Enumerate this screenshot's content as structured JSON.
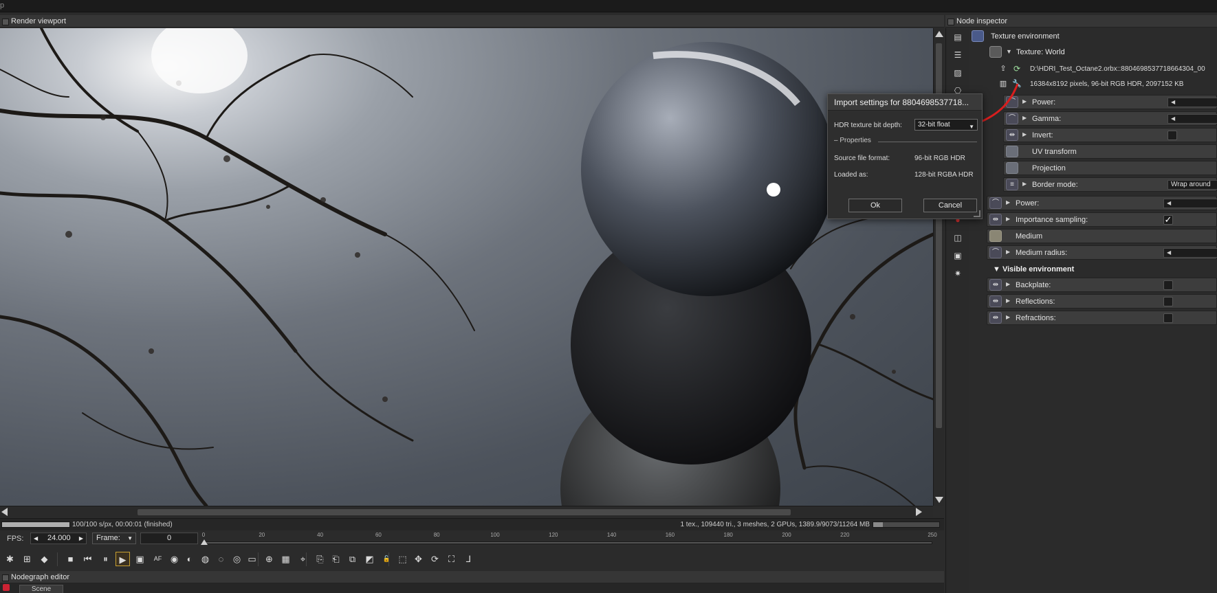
{
  "window": {
    "top_fragment": "p"
  },
  "viewport": {
    "title": "Render viewport",
    "status": "100/100 s/px, 00:00:01 (finished)",
    "stats": "1 tex., 109440 tri., 3 meshes, 2 GPUs, 1389.9/9073/11264 MB",
    "progress_fraction": 1.0,
    "memory_fraction": 0.15
  },
  "timeline": {
    "fps_label": "FPS:",
    "fps_value": "24.000",
    "frame_label": "Frame:",
    "frame_value": "0",
    "ticks": [
      "0",
      "20",
      "40",
      "60",
      "80",
      "100",
      "120",
      "140",
      "160",
      "180",
      "200",
      "220",
      "250"
    ],
    "tick_values": [
      0,
      20,
      40,
      60,
      80,
      100,
      120,
      140,
      160,
      180,
      200,
      220,
      250
    ],
    "range": [
      0,
      250
    ]
  },
  "toolbar": {
    "icons": [
      "reset-icon",
      "settings-icon",
      "cube-icon",
      "stop-icon",
      "restart-icon",
      "pause-icon",
      "play-icon",
      "display-icon",
      "af-icon",
      "color-icon",
      "cam-icon",
      "pick-icon",
      "pick2-icon",
      "pick3-icon",
      "region-icon",
      "zoom-icon",
      "crop-icon",
      "lock-icon",
      "export-icon",
      "import-icon",
      "layers-icon",
      "alpha-icon",
      "unlock-icon",
      "box-icon",
      "move-icon",
      "rotate-icon",
      "scale-icon",
      "axis-icon"
    ],
    "glyphs": [
      "✱",
      "⊞",
      "◆",
      "■",
      "⏮",
      "⏸",
      "▶",
      "▣",
      "AF",
      "◉",
      "◐",
      "◍",
      "◌",
      "◎",
      "▭",
      "⊕",
      "▦",
      "⌖",
      "⎘",
      "⎗",
      "⧉",
      "◩",
      "🔓",
      "⬚",
      "✥",
      "⟳",
      "⛶",
      "⅃"
    ]
  },
  "nodegraph": {
    "title": "Nodegraph editor",
    "tab": "Scene"
  },
  "inspector": {
    "title": "Node inspector",
    "node_name": "Texture environment",
    "texture_label": "Texture: World",
    "file_path": "D:\\HDRI_Test_Octane2.orbx::8804698537718664304_00",
    "file_info": "16384x8192 pixels, 96-bit RGB HDR, 2097152 KB",
    "rows": {
      "power": "Power:",
      "gamma": "Gamma:",
      "invert": "Invert:",
      "uv_transform": "UV transform",
      "projection": "Projection",
      "border_mode": "Border mode:",
      "border_mode_value": "Wrap around",
      "power2": "Power:",
      "importance_sampling": "Importance sampling:",
      "medium": "Medium",
      "medium_radius": "Medium radius:"
    },
    "visible_env_title": "Visible environment",
    "visible_rows": {
      "backplate": "Backplate:",
      "reflections": "Reflections:",
      "refractions": "Refractions:"
    }
  },
  "dialog": {
    "title": "Import settings for 8804698537718...",
    "bit_depth_label": "HDR texture bit depth:",
    "bit_depth_value": "32-bit float",
    "group_label": "– Properties",
    "source_label": "Source file format:",
    "source_value": "96-bit RGB HDR",
    "loaded_label": "Loaded as:",
    "loaded_value": "128-bit RGBA HDR",
    "ok": "Ok",
    "cancel": "Cancel"
  },
  "colors": {
    "accent_red": "#d81e1e",
    "active_border": "#c8a030"
  }
}
